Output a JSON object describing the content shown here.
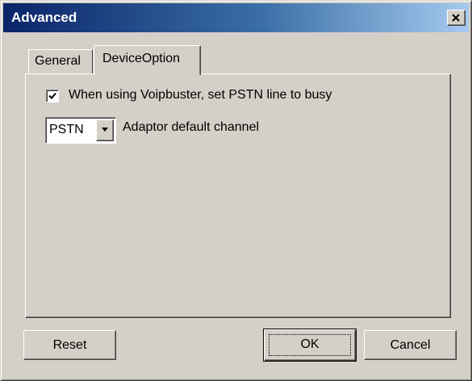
{
  "window": {
    "title": "Advanced",
    "colors": {
      "face": "#d4d0c8",
      "title_start": "#0a246a",
      "title_end": "#a6caf0"
    }
  },
  "tabs": [
    {
      "label": "General",
      "active": false
    },
    {
      "label": "DeviceOption",
      "active": true
    }
  ],
  "device_option": {
    "busy_checkbox": {
      "label": "When using Voipbuster, set PSTN line to busy",
      "checked": true
    },
    "channel_select": {
      "value": "PSTN",
      "label": "Adaptor default channel"
    }
  },
  "buttons": {
    "reset": "Reset",
    "ok": "OK",
    "cancel": "Cancel"
  },
  "icons": {
    "close": "close-icon",
    "check": "checkmark-icon",
    "dropdown": "chevron-down-icon"
  }
}
